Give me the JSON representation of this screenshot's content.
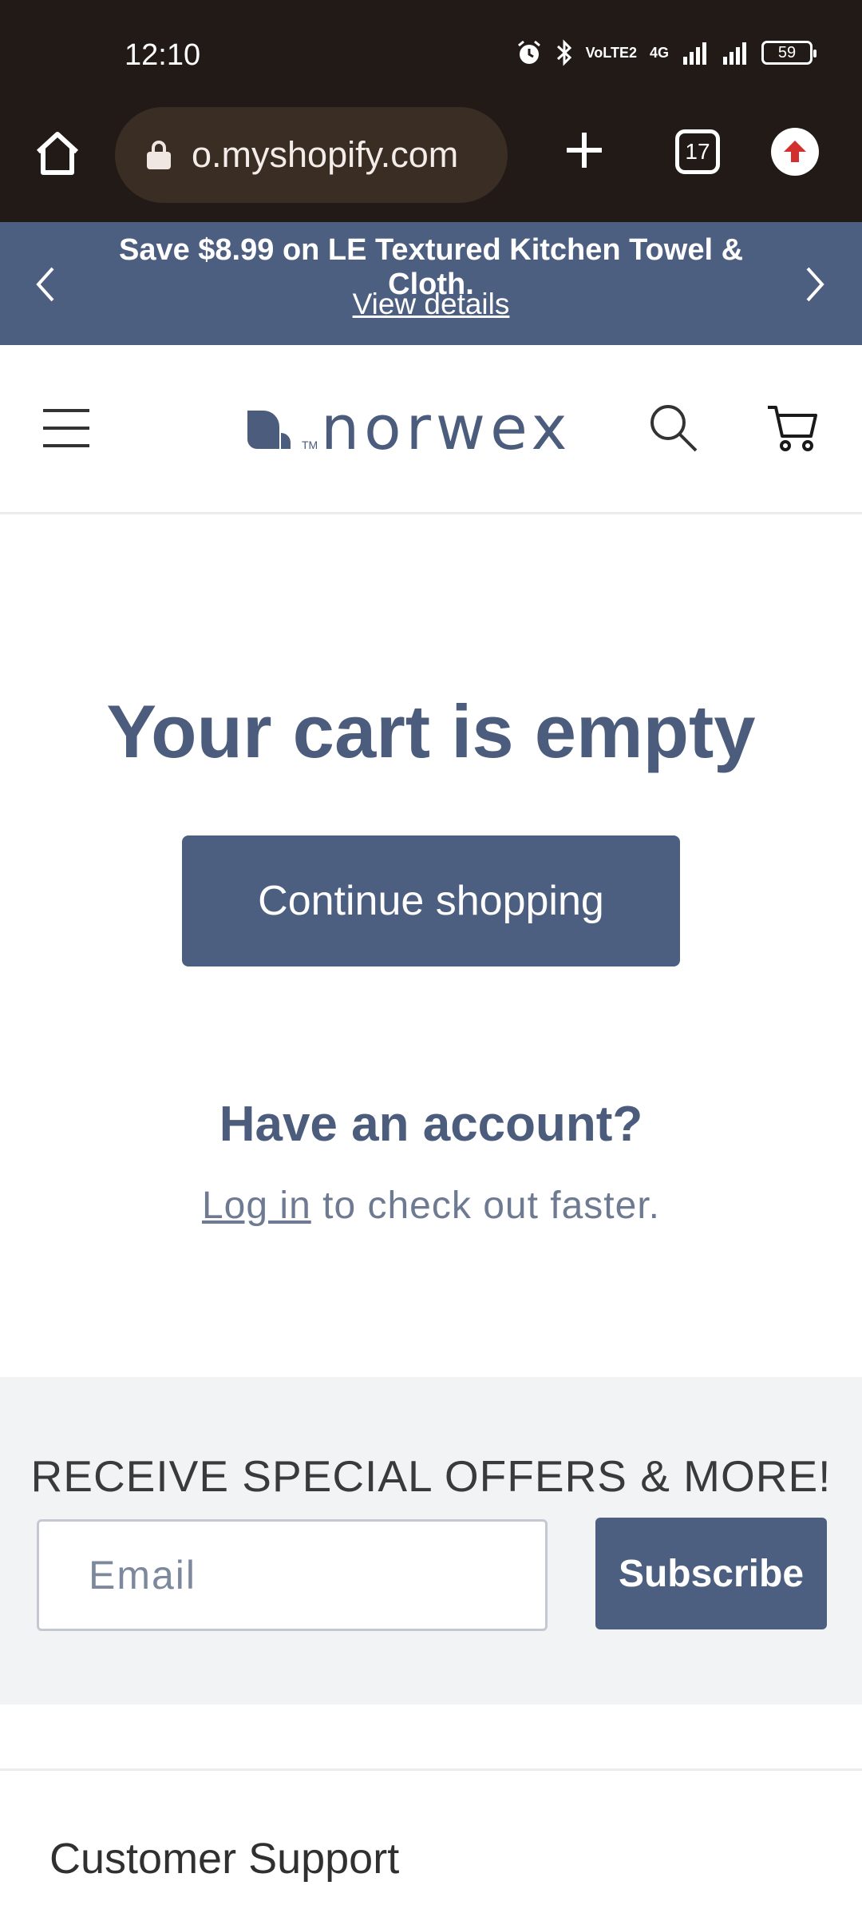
{
  "status_bar": {
    "time": "12:10",
    "network_label": "VoLTE2",
    "network_type": "4G",
    "battery": "59",
    "icons": [
      "alarm-icon",
      "bluetooth-icon",
      "signal-icon",
      "battery-icon"
    ]
  },
  "browser": {
    "url": "o.myshopify.com",
    "tab_count": "17"
  },
  "promo": {
    "text": "Save $8.99 on LE Textured Kitchen Towel & Cloth.",
    "link": "View details"
  },
  "header": {
    "logo_text": "norwex"
  },
  "cart": {
    "title": "Your cart is empty",
    "continue_label": "Continue shopping"
  },
  "account": {
    "title": "Have an account?",
    "login_link": "Log in",
    "login_suffix": " to check out faster."
  },
  "newsletter": {
    "title": "RECEIVE SPECIAL OFFERS & MORE!",
    "email_placeholder": "Email",
    "subscribe_label": "Subscribe"
  },
  "footer": {
    "support_title": "Customer Support"
  },
  "colors": {
    "brand": "#4d5f80",
    "status_bar": "#221a16",
    "newsletter_bg": "#f2f3f5"
  }
}
